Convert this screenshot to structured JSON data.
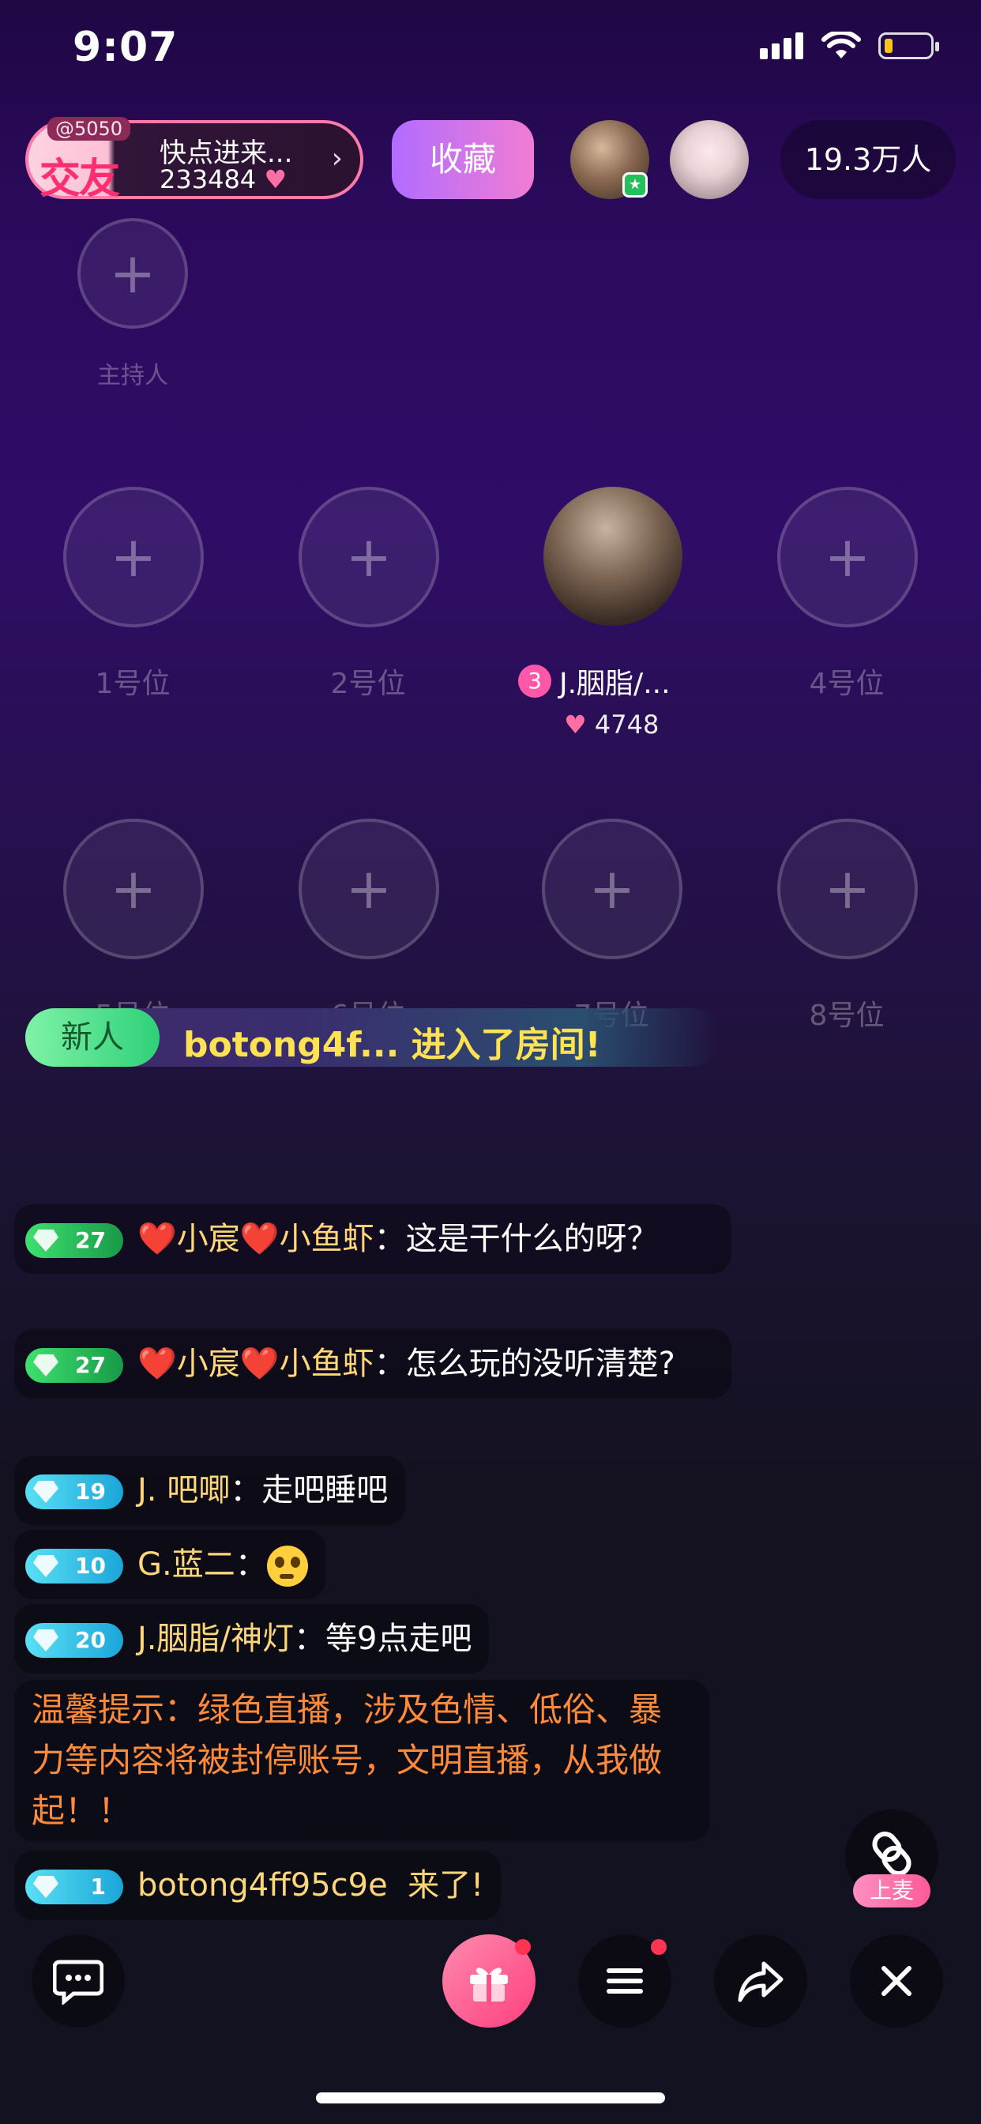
{
  "status_bar": {
    "time": "9:07"
  },
  "header": {
    "room_id": "@5050",
    "room_logo": "交友",
    "room_name": "快点进来...",
    "room_count": "233484",
    "arrow": "›",
    "favorite_label": "收藏",
    "viewers": "19.3万人"
  },
  "seats": {
    "host_label": "主持人",
    "plus": "+",
    "labels": [
      "1号位",
      "2号位",
      "3号位",
      "4号位",
      "5号位",
      "6号位",
      "7号位",
      "8号位"
    ],
    "occupied": {
      "position": "3",
      "name": "J.胭脂/...",
      "score": "4748"
    }
  },
  "entry_banner": {
    "tag": "新人",
    "text": "botong4f... 进入了房间!"
  },
  "chat": [
    {
      "level": "27",
      "user": "❤️小宸❤️小鱼虾",
      "sep": "：",
      "message": "这是干什么的呀？",
      "level_color": "green"
    },
    {
      "level": "27",
      "user": "❤️小宸❤️小鱼虾",
      "sep": "：",
      "message": "怎么玩的没听清楚?",
      "level_color": "green"
    },
    {
      "level": "19",
      "user": "J. 吧唧",
      "sep": "：",
      "message": "走吧睡吧",
      "level_color": "cyan"
    },
    {
      "level": "10",
      "user": "G.蓝二",
      "sep": "：",
      "message": "",
      "level_color": "cyan"
    },
    {
      "level": "20",
      "user": "J.胭脂/神灯",
      "sep": "：",
      "message": "等9点走吧",
      "level_color": "cyan"
    },
    {
      "notice": "温馨提示：绿色直播，涉及色情、低俗、暴力等内容将被封停账号，文明直播，从我做起！！"
    },
    {
      "level": "1",
      "user": "botong4ff95c9e",
      "message": "来了!",
      "level_color": "cyan"
    }
  ],
  "mic": {
    "label": "上麦"
  },
  "icons": {
    "chat": "chat-bubble-icon",
    "gift": "gift-icon",
    "menu": "menu-icon",
    "share": "share-icon",
    "close": "close-icon",
    "link": "link-icon"
  },
  "colors": {
    "accent": "#ff3f7d",
    "favorite": "#b16cff",
    "username": "#ffd77a",
    "notice": "#ff8a3a"
  }
}
